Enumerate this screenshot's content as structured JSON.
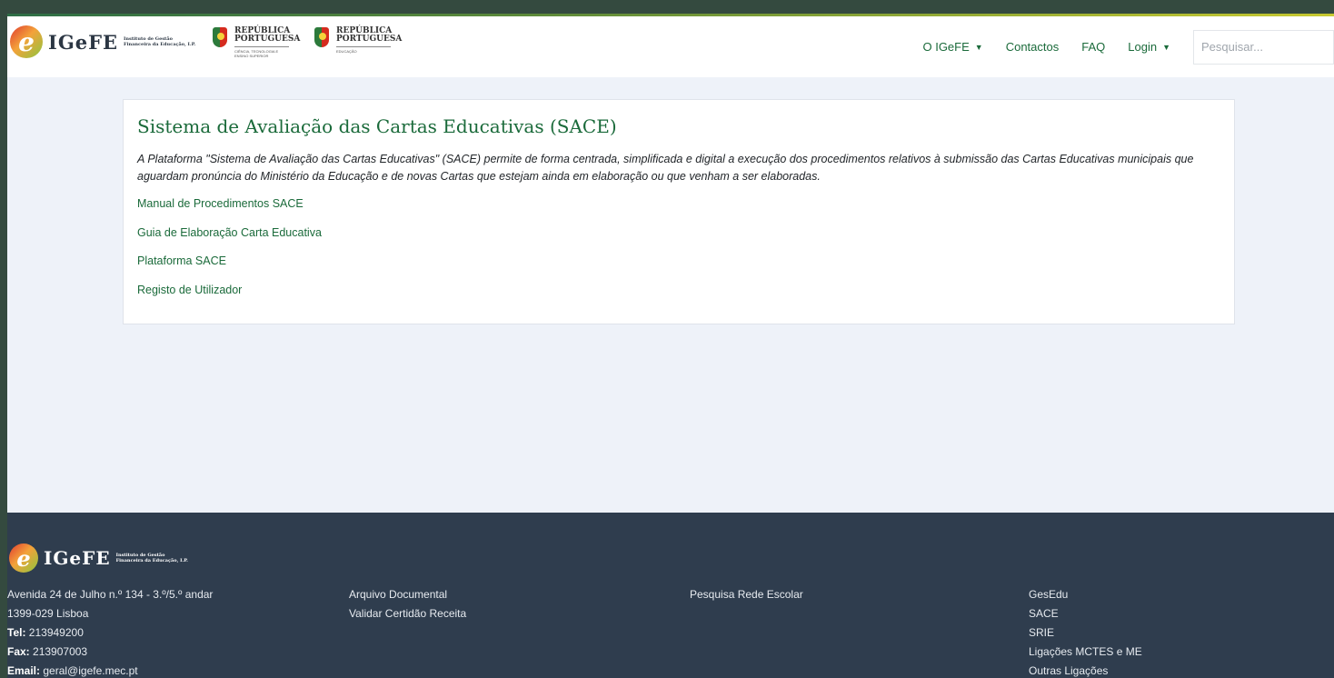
{
  "header": {
    "logo_text": "IGeFE",
    "logo_subtext": "Instituto de Gestão Financeira da Educação, I.P.",
    "rp1": {
      "title": "REPÚBLICA PORTUGUESA",
      "sub": "CIÊNCIA, TECNOLOGIA E ENSINO SUPERIOR"
    },
    "rp2": {
      "title": "REPÚBLICA PORTUGUESA",
      "sub": "EDUCAÇÃO"
    },
    "nav": {
      "o_igefe": "O IGeFE",
      "contactos": "Contactos",
      "faq": "FAQ",
      "login": "Login"
    },
    "search_placeholder": "Pesquisar..."
  },
  "main": {
    "title": "Sistema de Avaliação das Cartas Educativas (SACE)",
    "description": "A Plataforma \"Sistema de Avaliação das Cartas Educativas\" (SACE) permite de forma centrada, simplificada e digital a execução dos procedimentos relativos à submissão das Cartas Educativas municipais que aguardam pronúncia do Ministério da Educação e de novas Cartas que estejam ainda em elaboração ou que venham a ser elaboradas.",
    "links": [
      "Manual de Procedimentos SACE",
      "Guia de Elaboração Carta Educativa",
      "Plataforma SACE",
      "Registo de Utilizador"
    ]
  },
  "footer": {
    "logo_text": "IGeFE",
    "logo_subtext": "Instituto de Gestão Financeira da Educação, I.P.",
    "address_line1": "Avenida 24 de Julho n.º 134 - 3.º/5.º andar",
    "address_line2": "1399-029 Lisboa",
    "tel_label": "Tel:",
    "tel_value": "213949200",
    "fax_label": "Fax:",
    "fax_value": "213907003",
    "email_label": "Email:",
    "email_value": "geral@igefe.mec.pt",
    "col2": [
      "Arquivo Documental",
      "Validar Certidão Receita"
    ],
    "col3": [
      "Pesquisa Rede Escolar"
    ],
    "col4": [
      "GesEdu",
      "SACE",
      "SRIE",
      "Ligações MCTES e ME",
      "Outras Ligações"
    ]
  }
}
